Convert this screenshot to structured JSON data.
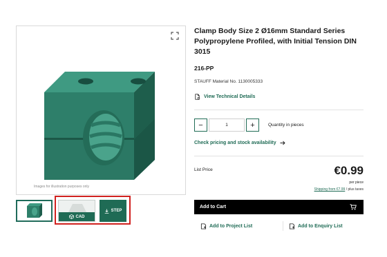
{
  "gallery": {
    "disclaimer": "Images for illustration purposes only",
    "cad_label": "CAD",
    "step_label": "STEP",
    "icons": [
      "expand-icon",
      "cad-icon",
      "download-icon"
    ]
  },
  "product": {
    "title": "Clamp Body Size 2 Ø16mm Standard Series Polypropylene Profiled, with Initial Tension DIN 3015",
    "sku": "216-PP",
    "material": "STAUFF Material No. 1130005333",
    "tech_link": "View Technical Details"
  },
  "quantity": {
    "minus": "−",
    "value": "1",
    "plus": "+",
    "label": "Quantity in pieces"
  },
  "availability_link": "Check pricing and stock availability",
  "pricing": {
    "label": "List Price",
    "price": "€0.99",
    "per_piece": "per piece",
    "shipping_link": "Shipping from €7.99",
    "shipping_suffix": "/ plus taxes"
  },
  "actions": {
    "add_to_cart": "Add to Cart",
    "add_to_project": "Add to Project List",
    "add_to_enquiry": "Add to Enquiry List"
  },
  "colors": {
    "brand": "#1f6b55",
    "product": "#2e7f6a",
    "highlight": "#d0201e"
  }
}
